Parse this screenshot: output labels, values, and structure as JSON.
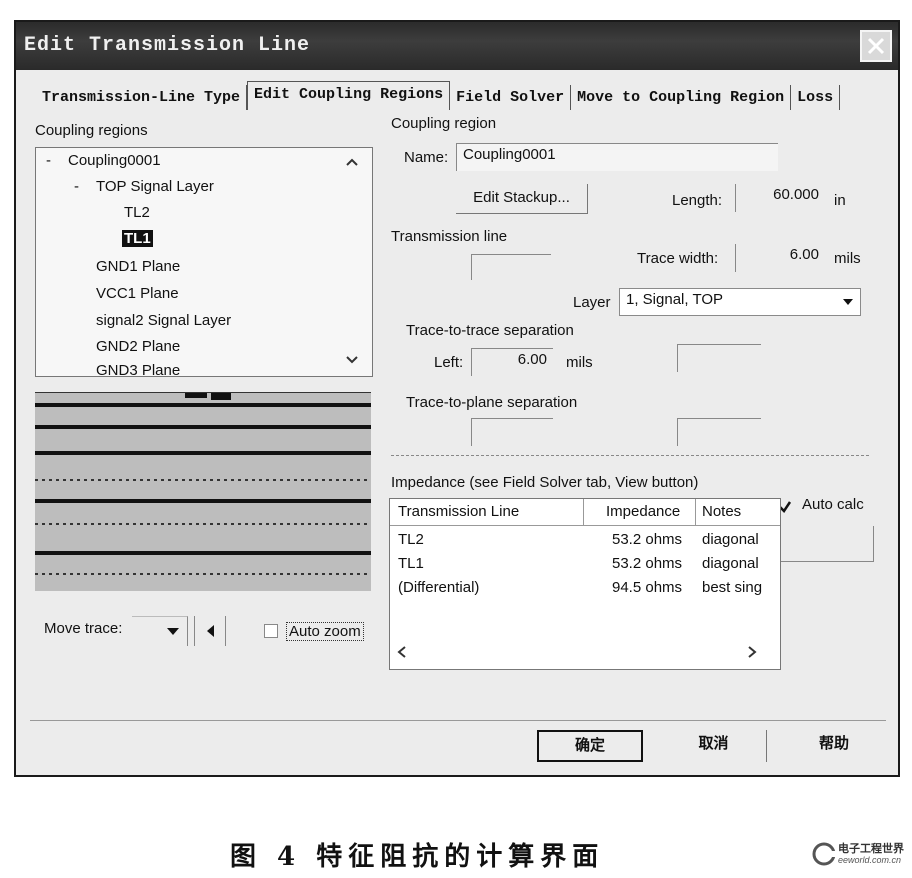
{
  "window": {
    "title": "Edit Transmission Line"
  },
  "tabs": [
    {
      "label": "Transmission-Line Type"
    },
    {
      "label": "Edit Coupling Regions"
    },
    {
      "label": "Field Solver"
    },
    {
      "label": "Move to Coupling Region"
    },
    {
      "label": "Loss"
    }
  ],
  "left": {
    "coupling_regions_label": "Coupling regions",
    "tree": {
      "root_toggle": "-",
      "root": "Coupling0001",
      "layer_toggle": "-",
      "layer": "TOP Signal Layer",
      "children": [
        "TL2",
        "TL1"
      ],
      "selected": "TL1",
      "others": [
        "GND1 Plane",
        "VCC1 Plane",
        "signal2 Signal Layer",
        "GND2 Plane",
        "GND3 Plane"
      ]
    },
    "move_trace_label": "Move trace:",
    "auto_zoom_label": "Auto zoom",
    "auto_zoom_checked": false
  },
  "region": {
    "heading": "Coupling region",
    "name_label": "Name:",
    "name_value": "Coupling0001",
    "edit_stackup_label": "Edit Stackup...",
    "length_label": "Length:",
    "length_value": "60.000",
    "length_unit": "in"
  },
  "tline": {
    "heading": "Transmission line",
    "trace_width_label": "Trace width:",
    "trace_width_value": "6.00",
    "trace_width_unit": "mils",
    "layer_label": "Layer",
    "layer_value": "1, Signal, TOP"
  },
  "separation": {
    "trace_heading": "Trace-to-trace separation",
    "left_label": "Left:",
    "left_value": "6.00",
    "left_unit": "mils",
    "plane_heading": "Trace-to-plane separation"
  },
  "impedance": {
    "heading": "Impedance (see Field Solver tab, View button)",
    "auto_calc_label": "Auto calc",
    "auto_calc_checked": true,
    "columns": [
      "Transmission Line",
      "Impedance",
      "Notes"
    ],
    "rows": [
      {
        "line": "TL2",
        "impedance": "53.2 ohms",
        "notes": "diagonal"
      },
      {
        "line": "TL1",
        "impedance": "53.2 ohms",
        "notes": "diagonal"
      },
      {
        "line": "(Differential)",
        "impedance": "94.5 ohms",
        "notes": "best sing"
      }
    ]
  },
  "buttons": {
    "ok": "确定",
    "cancel": "取消",
    "help": "帮助"
  },
  "caption": "图 4   特征阻抗的计算界面",
  "watermark": {
    "line1": "电子工程世界",
    "line2": "eeworld.com.cn"
  }
}
